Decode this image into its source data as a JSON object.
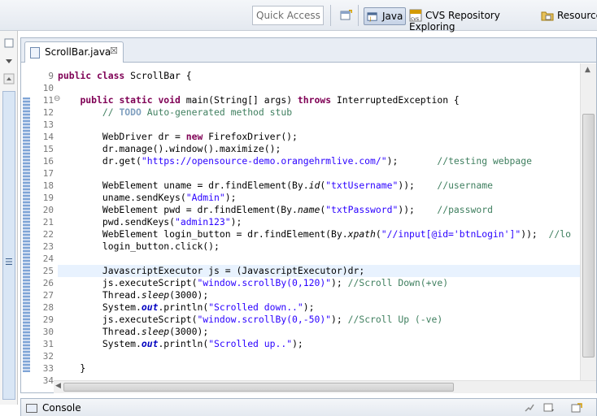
{
  "toolbar": {
    "quick_access_placeholder": "Quick Access",
    "perspectives": [
      {
        "label": "Java",
        "active": true
      },
      {
        "label": "CVS Repository Exploring",
        "active": false
      },
      {
        "label": "Resource",
        "active": false
      }
    ]
  },
  "editor": {
    "tab_label": "ScrollBar.java",
    "tab_close": "☒",
    "lines": [
      {
        "num": "9",
        "html": "<span class=\"kw\">public class</span> ScrollBar {"
      },
      {
        "num": "10",
        "html": ""
      },
      {
        "num": "11",
        "html": "    <span class=\"kw\">public static void</span> main(String[] args) <span class=\"kw\">throws</span> InterruptedException {"
      },
      {
        "num": "12",
        "html": "        <span class=\"cmt\">// <span class=\"todo\">TODO</span> Auto-generated method stub</span>"
      },
      {
        "num": "13",
        "html": ""
      },
      {
        "num": "14",
        "html": "        WebDriver dr = <span class=\"kw\">new</span> FirefoxDriver();"
      },
      {
        "num": "15",
        "html": "        dr.manage().window().maximize();"
      },
      {
        "num": "16",
        "html": "        dr.get(<span class=\"str\">\"https://opensource-demo.orangehrmlive.com/\"</span>);       <span class=\"cmt\">//testing webpage</span>"
      },
      {
        "num": "17",
        "html": ""
      },
      {
        "num": "18",
        "html": "        WebElement uname = dr.findElement(By.<span class=\"it\">id</span>(<span class=\"str\">\"txtUsername\"</span>));    <span class=\"cmt\">//username</span>"
      },
      {
        "num": "19",
        "html": "        uname.sendKeys(<span class=\"str\">\"Admin\"</span>);"
      },
      {
        "num": "20",
        "html": "        WebElement pwd = dr.findElement(By.<span class=\"it\">name</span>(<span class=\"str\">\"txtPassword\"</span>));    <span class=\"cmt\">//password</span>"
      },
      {
        "num": "21",
        "html": "        pwd.sendKeys(<span class=\"str\">\"admin123\"</span>);"
      },
      {
        "num": "22",
        "html": "        WebElement login_button = dr.findElement(By.<span class=\"it\">xpath</span>(<span class=\"str\">\"//input[@id='btnLogin']\"</span>));  <span class=\"cmt\">//lo</span>"
      },
      {
        "num": "23",
        "html": "        login_button.click();"
      },
      {
        "num": "24",
        "html": ""
      },
      {
        "num": "25",
        "html": "        JavascriptExecutor js = (JavascriptExecutor)dr;",
        "highlight": true
      },
      {
        "num": "26",
        "html": "        js.executeScript(<span class=\"str\">\"window.scrollBy(0,120)\"</span>); <span class=\"cmt\">//Scroll Down(+ve)</span>"
      },
      {
        "num": "27",
        "html": "        Thread.<span class=\"it\">sleep</span>(3000);"
      },
      {
        "num": "28",
        "html": "        System.<span class=\"fld\">out</span>.println(<span class=\"str\">\"Scrolled down..\"</span>);"
      },
      {
        "num": "29",
        "html": "        js.executeScript(<span class=\"str\">\"window.scrollBy(0,-50)\"</span>); <span class=\"cmt\">//Scroll Up (-ve)</span>"
      },
      {
        "num": "30",
        "html": "        Thread.<span class=\"it\">sleep</span>(3000);"
      },
      {
        "num": "31",
        "html": "        System.<span class=\"fld\">out</span>.println(<span class=\"str\">\"Scrolled up..\"</span>);"
      },
      {
        "num": "32",
        "html": ""
      },
      {
        "num": "33",
        "html": "    }"
      },
      {
        "num": "34",
        "html": ""
      }
    ]
  },
  "console": {
    "tab_label": "Console"
  },
  "colors": {
    "keyword": "#7f0055",
    "string": "#2a00ff",
    "comment": "#3f7f5f",
    "line_highlight": "#e8f2fe"
  }
}
